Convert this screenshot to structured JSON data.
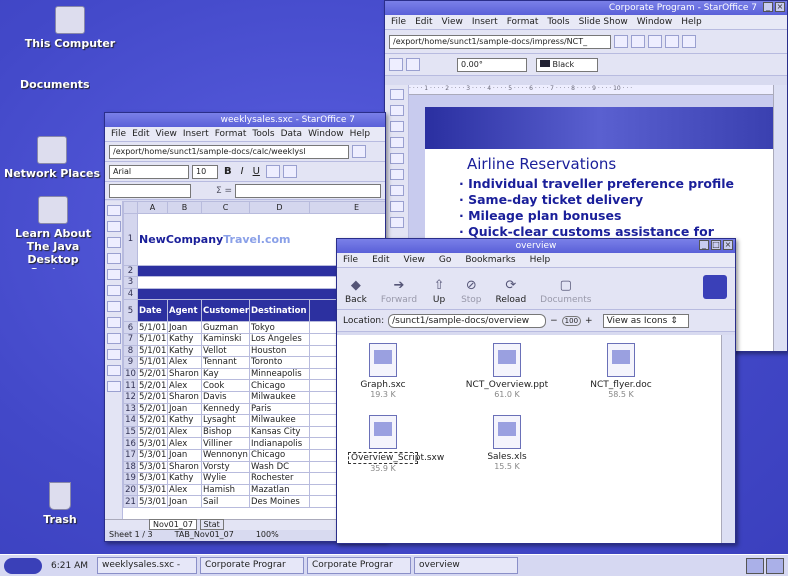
{
  "desktop": {
    "icons": [
      {
        "label": "This Computer"
      },
      {
        "label": "Documents"
      },
      {
        "label": "Network Places"
      },
      {
        "label": "Learn About The Java Desktop System"
      },
      {
        "label": "Trash"
      }
    ]
  },
  "impress": {
    "title": "Corporate Program - StarOffice 7",
    "menu": [
      "File",
      "Edit",
      "View",
      "Insert",
      "Format",
      "Tools",
      "Slide Show",
      "Window",
      "Help"
    ],
    "url": "/export/home/sunct1/sample-docs/impress/NCT_",
    "angle": "0.00°",
    "color": "Black",
    "slide_title": "Airline Reservations",
    "bullets": [
      "Individual traveller preference profile",
      "Same-day ticket delivery",
      "Mileage plan bonuses",
      "Quick-clear customs assistance for"
    ]
  },
  "calc": {
    "title": "weeklysales.sxc - StarOffice 7",
    "menu": [
      "File",
      "Edit",
      "View",
      "Insert",
      "Format",
      "Tools",
      "Data",
      "Window",
      "Help"
    ],
    "url": "/export/home/sunct1/sample-docs/calc/weeklysl",
    "font": "Arial",
    "size": "10",
    "cols": [
      "A",
      "B",
      "C",
      "D",
      "E"
    ],
    "logo_a": "NewCompany",
    "logo_b": "Travel.com",
    "headers": [
      "Date",
      "Agent",
      "Customer",
      "Destination"
    ],
    "rows": [
      [
        "6",
        "5/1/01",
        "Joan",
        "Guzman",
        "Tokyo"
      ],
      [
        "7",
        "5/1/01",
        "Kathy",
        "Kaminski",
        "Los Angeles"
      ],
      [
        "8",
        "5/1/01",
        "Kathy",
        "Vellot",
        "Houston"
      ],
      [
        "9",
        "5/1/01",
        "Alex",
        "Tennant",
        "Toronto"
      ],
      [
        "10",
        "5/2/01",
        "Sharon",
        "Kay",
        "Minneapolis"
      ],
      [
        "11",
        "5/2/01",
        "Alex",
        "Cook",
        "Chicago"
      ],
      [
        "12",
        "5/2/01",
        "Sharon",
        "Davis",
        "Milwaukee"
      ],
      [
        "13",
        "5/2/01",
        "Joan",
        "Kennedy",
        "Paris"
      ],
      [
        "14",
        "5/2/01",
        "Kathy",
        "Lysaght",
        "Milwaukee"
      ],
      [
        "15",
        "5/2/01",
        "Alex",
        "Bishop",
        "Kansas City"
      ],
      [
        "16",
        "5/3/01",
        "Alex",
        "Villiner",
        "Indianapolis"
      ],
      [
        "17",
        "5/3/01",
        "Joan",
        "Wennonyn",
        "Chicago"
      ],
      [
        "18",
        "5/3/01",
        "Sharon",
        "Vorsty",
        "Wash DC"
      ],
      [
        "19",
        "5/3/01",
        "Kathy",
        "Wylie",
        "Rochester"
      ],
      [
        "20",
        "5/3/01",
        "Alex",
        "Hamish",
        "Mazatlan"
      ],
      [
        "21",
        "5/3/01",
        "Joan",
        "Sail",
        "Des Moines"
      ]
    ],
    "sheet_tab": "Nov01_07",
    "sheet_tab2": "Stat",
    "status_sheet": "Sheet 1 / 3",
    "status_page": "TAB_Nov01_07",
    "status_zoom": "100%"
  },
  "nautilus": {
    "title": "overview",
    "menu": [
      "File",
      "Edit",
      "View",
      "Go",
      "Bookmarks",
      "Help"
    ],
    "nav": [
      {
        "label": "Back",
        "icon": "◆",
        "enabled": true
      },
      {
        "label": "Forward",
        "icon": "➔",
        "enabled": false
      },
      {
        "label": "Up",
        "icon": "⇧",
        "enabled": true
      },
      {
        "label": "Stop",
        "icon": "⊘",
        "enabled": false
      },
      {
        "label": "Reload",
        "icon": "⟳",
        "enabled": true
      },
      {
        "label": "Documents",
        "icon": "▢",
        "enabled": true
      }
    ],
    "location_label": "Location:",
    "location": "/sunct1/sample-docs/overview",
    "zoom": "100",
    "view_as": "View as Icons",
    "files": [
      {
        "name": "Graph.sxc",
        "size": "19.3 K"
      },
      {
        "name": "NCT_Overview.ppt",
        "size": "61.0 K"
      },
      {
        "name": "NCT_flyer.doc",
        "size": "58.5 K"
      },
      {
        "name": "Overview_Script.sxw",
        "size": "35.9 K"
      },
      {
        "name": "Sales.xls",
        "size": "15.5 K"
      }
    ]
  },
  "taskbar": {
    "clock": "6:21 AM",
    "tasks": [
      "weeklysales.sxc -",
      "Corporate Prograr",
      "Corporate Prograr",
      "overview"
    ]
  }
}
